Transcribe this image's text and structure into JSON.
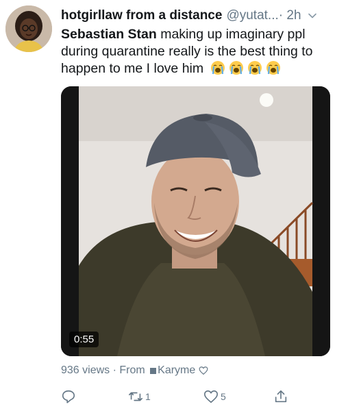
{
  "tweet": {
    "display_name": "hotgirllaw from a distance",
    "handle": "@yutat...",
    "time": "· 2h",
    "mention": "Sebastian Stan",
    "text": " making up imaginary ppl during quarantine really is the best thing to happen to me I love him",
    "emoji_icons": [
      "loudly-crying-face-icon",
      "loudly-crying-face-icon",
      "loudly-crying-face-icon",
      "loudly-crying-face-icon"
    ]
  },
  "media": {
    "duration": "0:55"
  },
  "meta": {
    "views": "936 views",
    "separator": " · From ",
    "source": "Karyme"
  },
  "actions": {
    "reply_count": "",
    "retweet_count": "1",
    "like_count": "5"
  },
  "colors": {
    "text": "#14171a",
    "secondary": "#657786",
    "emoji_face": "#ffcc4d",
    "tears": "#5dadec"
  }
}
